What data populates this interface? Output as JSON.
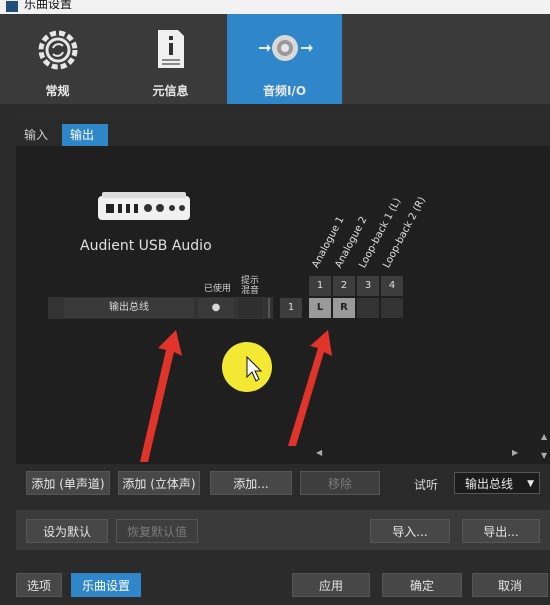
{
  "window": {
    "title": "乐曲设置"
  },
  "top_tabs": [
    {
      "label": "常规",
      "icon": "refresh-gear-icon"
    },
    {
      "label": "元信息",
      "icon": "info-document-icon"
    },
    {
      "label": "音频I/O",
      "icon": "speaker-io-icon",
      "active": true
    }
  ],
  "sub_tabs": {
    "input": "输入",
    "output": "输出",
    "active": "output"
  },
  "device": {
    "name": "Audient USB Audio",
    "icon": "audio-interface-icon"
  },
  "columns": {
    "used": "已使用",
    "cue_mix": "提示\n混音"
  },
  "channels": {
    "numbers": [
      "1",
      "2",
      "3",
      "4"
    ],
    "labels": [
      "Analogue 1",
      "Analogue 2",
      "Loop-back 1 (L)",
      "Loop-back 2 (R)"
    ]
  },
  "output_row": {
    "name": "输出总线",
    "used_indicator": "●",
    "channel_number": "1",
    "assign_left": "L",
    "assign_right": "R"
  },
  "buttons": {
    "add_mono": "添加 (单声道)",
    "add_stereo": "添加 (立体声)",
    "add_more": "添加...",
    "remove": "移除",
    "set_default": "设为默认",
    "restore_default": "恢复默认值",
    "import": "导入...",
    "export": "导出...",
    "options": "选项",
    "song_settings": "乐曲设置",
    "apply": "应用",
    "ok": "确定",
    "cancel": "取消"
  },
  "audition": {
    "label": "试听",
    "value": "输出总线"
  },
  "colors": {
    "accent": "#2f86c9",
    "annotation_arrow": "#e0342a",
    "cursor_highlight": "#f3e832"
  }
}
